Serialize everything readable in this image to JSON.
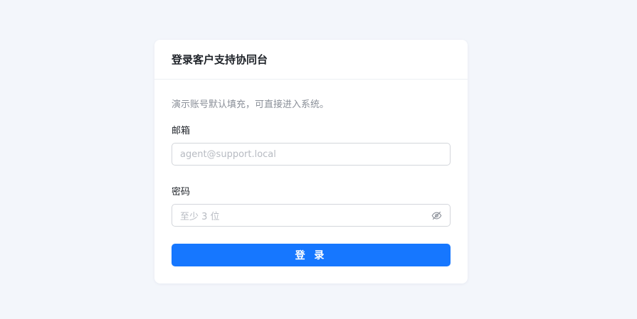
{
  "login": {
    "title": "登录客户支持协同台",
    "hint": "演示账号默认填充，可直接进入系统。",
    "email_label": "邮箱",
    "email_placeholder": "agent@support.local",
    "password_label": "密码",
    "password_placeholder": "至少 3 位",
    "password_toggle_icon": "eye-off-icon",
    "submit_label": "登 录"
  },
  "colors": {
    "background": "#f3f6fb",
    "primary": "#1677ff",
    "card": "#ffffff"
  }
}
